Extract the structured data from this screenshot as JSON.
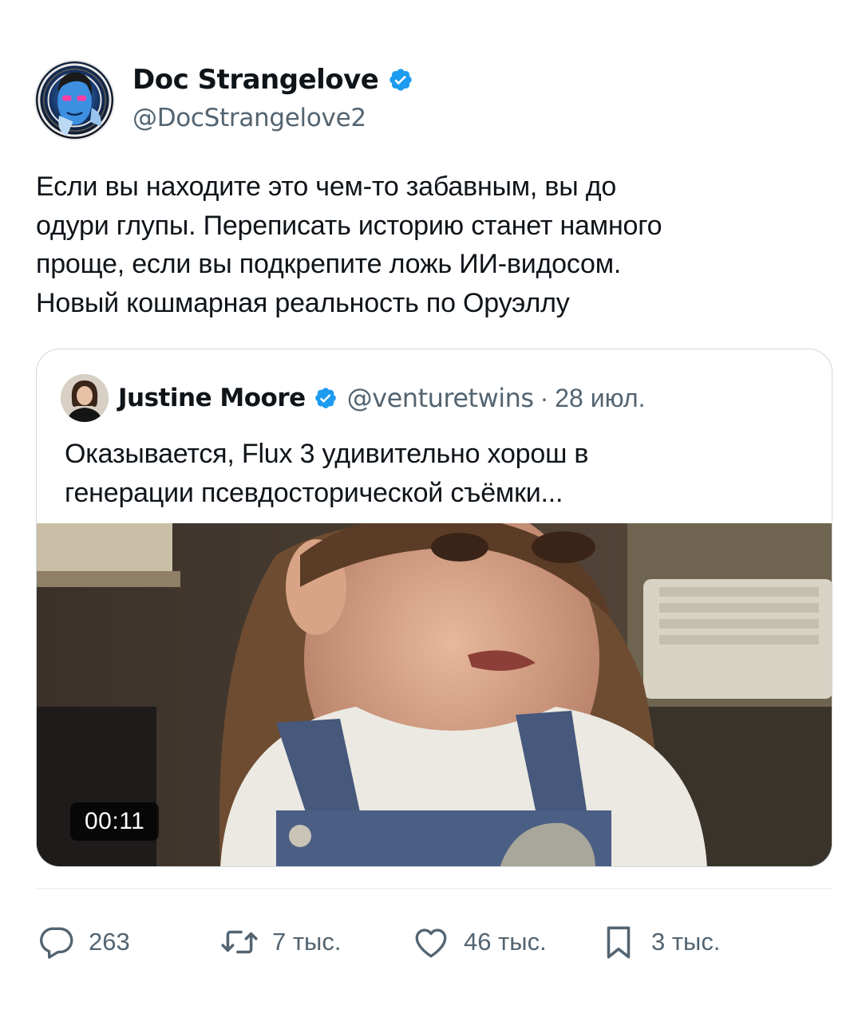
{
  "post": {
    "author_name": "Doc Strangelove",
    "author_handle": "@DocStrangelove2",
    "text_lines": [
      "Если вы находите это чем-то забавным, вы до",
      "одури глупы. Переписать историю станет намного",
      "проще, если вы подкрепите ложь ИИ-видосом.",
      "Новый кошмарная реальность по Оруэллу"
    ]
  },
  "quote": {
    "author_name": "Justine Moore",
    "author_handle": "@venturetwins",
    "separator": "·",
    "date": "28 июл.",
    "text_lines": [
      "Оказывается, Flux 3 удивительно хорош в",
      "генерации псевдосторической съёмки..."
    ],
    "video_duration": "00:11"
  },
  "actions": {
    "replies": "263",
    "reposts": "7 тыс.",
    "likes": "46 тыс.",
    "bookmarks": "3 тыс."
  },
  "icons": {
    "verified": "verified-badge-icon",
    "reply": "speech-bubble-icon",
    "repost": "repost-arrows-icon",
    "like": "heart-icon",
    "bookmark": "bookmark-icon"
  },
  "colors": {
    "verified_blue": "#1d9bf0",
    "text_primary": "#0f1419",
    "text_secondary": "#536471",
    "border": "#cfd9de"
  }
}
